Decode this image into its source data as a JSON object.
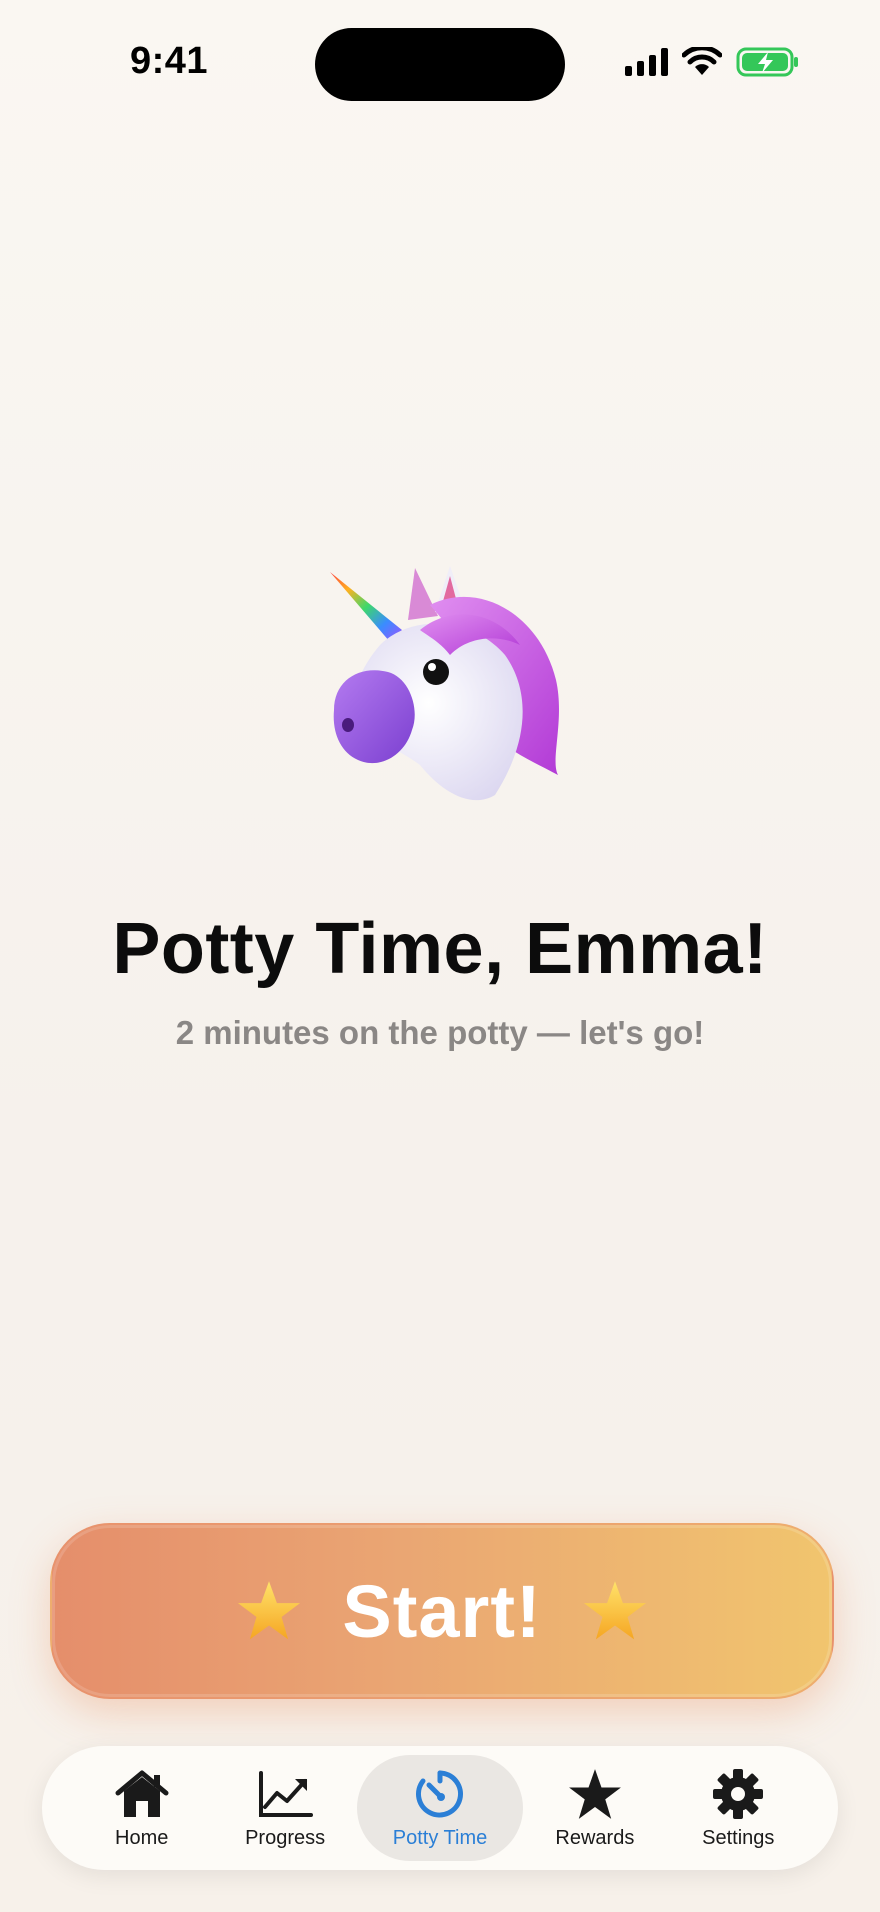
{
  "status_bar": {
    "time": "9:41"
  },
  "hero": {
    "emoji_icon": "unicorn-icon",
    "title": "Potty Time, Emma!",
    "subtitle": "2 minutes on the potty — let's go!"
  },
  "start_button": {
    "label": "Start!",
    "decoration_icon": "star-icon"
  },
  "tab_bar": {
    "active_tab": "Potty Time",
    "active_color": "#2b7fd6",
    "items": [
      {
        "label": "Home",
        "icon": "house-icon"
      },
      {
        "label": "Progress",
        "icon": "chart-line-icon"
      },
      {
        "label": "Potty Time",
        "icon": "timer-icon"
      },
      {
        "label": "Rewards",
        "icon": "star-icon"
      },
      {
        "label": "Settings",
        "icon": "gear-icon"
      }
    ]
  },
  "colors": {
    "background": "#f8f5f0",
    "button_gradient_start": "#e58e6b",
    "button_gradient_end": "#f1c56e",
    "battery_green": "#34c759"
  }
}
